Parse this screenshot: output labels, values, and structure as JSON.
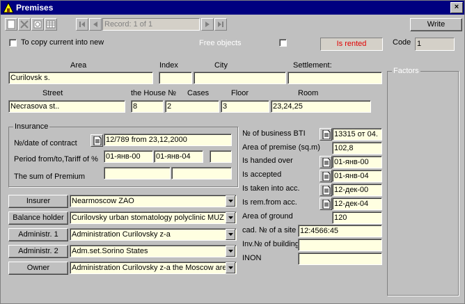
{
  "window": {
    "title": "Premises",
    "close_glyph": "×"
  },
  "toolbar": {
    "record_text": "Record: 1 of 1",
    "write_label": "Write"
  },
  "options": {
    "copy_label": "To copy current into new",
    "free_label": "Free objects",
    "rented_text": "Is rented",
    "code_label": "Code",
    "code_value": "1"
  },
  "location": {
    "area_label": "Area",
    "index_label": "Index",
    "city_label": "City",
    "settlement_label": "Settlement:",
    "area_value": "Curilovsk s.",
    "index_value": "",
    "city_value": "",
    "settlement_value": "",
    "street_label": "Street",
    "house_label": "the House №",
    "cases_label": "Cases",
    "floor_label": "Floor",
    "room_label": "Room",
    "street_value": "Necrasova st..",
    "house_value": "8",
    "cases_value": "2",
    "floor_value": "3",
    "room_value": "23,24,25"
  },
  "insurance": {
    "group_title": "Insurance",
    "contract_label": "№/date of contract",
    "contract_value": "12/789 from 23,12,2000",
    "period_label": "Period from/to,Tariff of %",
    "period_from": "01-янв-00",
    "period_to": "01-янв-04",
    "tariff": "",
    "premium_label": "The sum of Premium",
    "premium_1": "",
    "premium_2": ""
  },
  "right": {
    "bti_label": "№ of business BTI",
    "bti_value": "13315 от 04.",
    "area_label": "Area of premise (sq.m)",
    "area_value": "102,8",
    "handed_label": "Is handed over",
    "handed_value": "01-янв-00",
    "accepted_label": "Is accepted",
    "accepted_value": "01-янв-04",
    "taken_label": "Is taken into acc.",
    "taken_value": "12-дек-00",
    "remfrom_label": "Is rem.from acc.",
    "remfrom_value": "12-дек-04",
    "ground_label": "Area of ground",
    "ground_value": "120",
    "cad_label": "cad. № of a site",
    "cad_value": "12:4566:45",
    "inv_label": "Inv.№ of building",
    "inv_value": "",
    "inon_label": "INON",
    "inon_value": ""
  },
  "parties": [
    {
      "button": "Insurer",
      "value": "Nearmoscow ZAO"
    },
    {
      "button": "Balance holder",
      "value": "Curilovsky urban stomatology polyclinic MUZ"
    },
    {
      "button": "Administr. 1",
      "value": "Administration Curilovsky z-a"
    },
    {
      "button": "Administr. 2",
      "value": "Adm.set.Sorino States"
    },
    {
      "button": "Owner",
      "value": "Administration Curilovsky z-a the Moscow area"
    }
  ],
  "factors": {
    "title": "Factors"
  },
  "colors": {
    "title_bar": "#000080",
    "field_bg": "#ffffe1",
    "rented_text": "#e00000",
    "disabled_text": "#ffffff"
  }
}
